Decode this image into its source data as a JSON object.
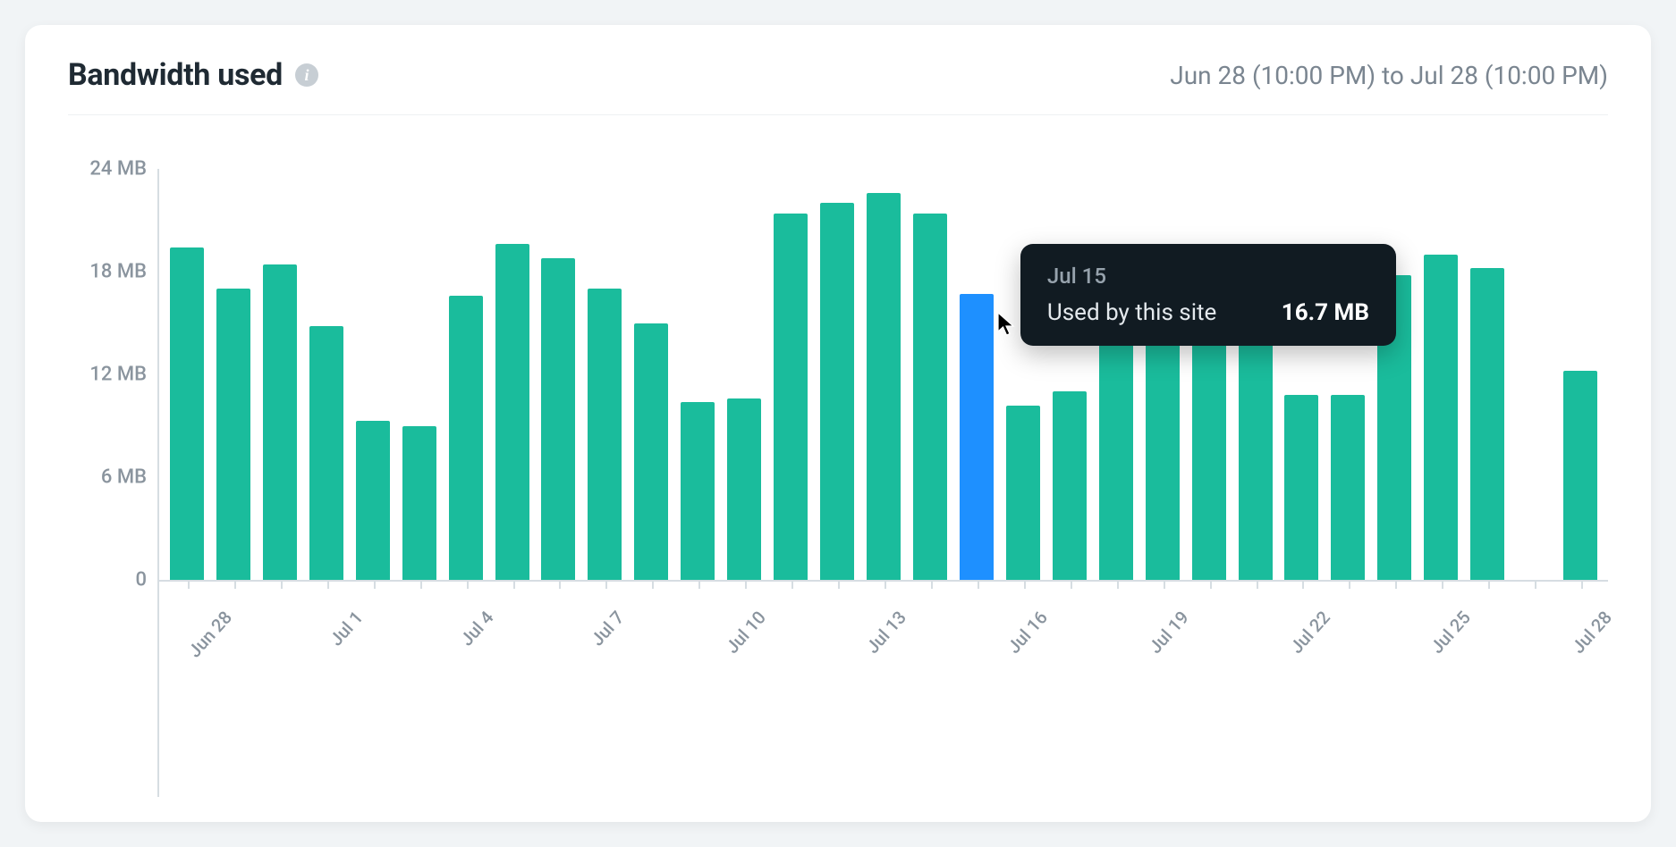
{
  "header": {
    "title": "Bandwidth used",
    "range": "Jun 28 (10:00 PM) to Jul 28 (10:00 PM)"
  },
  "tooltip": {
    "date": "Jul 15",
    "label": "Used by this site",
    "value": "16.7 MB"
  },
  "chart_data": {
    "type": "bar",
    "title": "Bandwidth used",
    "ylabel": "MB",
    "xlabel": "",
    "ylim": [
      0,
      24
    ],
    "y_ticks": [
      "24 MB",
      "18 MB",
      "12 MB",
      "6 MB",
      "0"
    ],
    "x_tick_labels": [
      "Jun 28",
      "",
      "",
      "Jul 1",
      "",
      "",
      "Jul 4",
      "",
      "",
      "Jul 7",
      "",
      "",
      "Jul 10",
      "",
      "",
      "Jul 13",
      "",
      "",
      "Jul 16",
      "",
      "",
      "Jul 19",
      "",
      "",
      "Jul 22",
      "",
      "",
      "Jul 25",
      "",
      "",
      "Jul 28"
    ],
    "categories": [
      "Jun 28",
      "Jun 29",
      "Jun 30",
      "Jul 1",
      "Jul 2",
      "Jul 3",
      "Jul 4",
      "Jul 5",
      "Jul 6",
      "Jul 7",
      "Jul 8",
      "Jul 9",
      "Jul 10",
      "Jul 11",
      "Jul 12",
      "Jul 13",
      "Jul 14",
      "Jul 15",
      "Jul 16",
      "Jul 17",
      "Jul 18",
      "Jul 19",
      "Jul 20",
      "Jul 21",
      "Jul 22",
      "Jul 23",
      "Jul 24",
      "Jul 25",
      "Jul 26",
      "Jul 27",
      "Jul 28"
    ],
    "values": [
      19.4,
      17.0,
      18.4,
      14.8,
      9.3,
      9.0,
      16.6,
      19.6,
      18.8,
      17.0,
      15.0,
      10.4,
      10.6,
      21.4,
      22.0,
      22.6,
      21.4,
      16.7,
      10.2,
      11.0,
      16.4,
      16.4,
      16.6,
      16.4,
      10.8,
      10.8,
      17.8,
      19.0,
      18.2,
      0.0,
      12.2
    ],
    "highlight_index": 17
  }
}
